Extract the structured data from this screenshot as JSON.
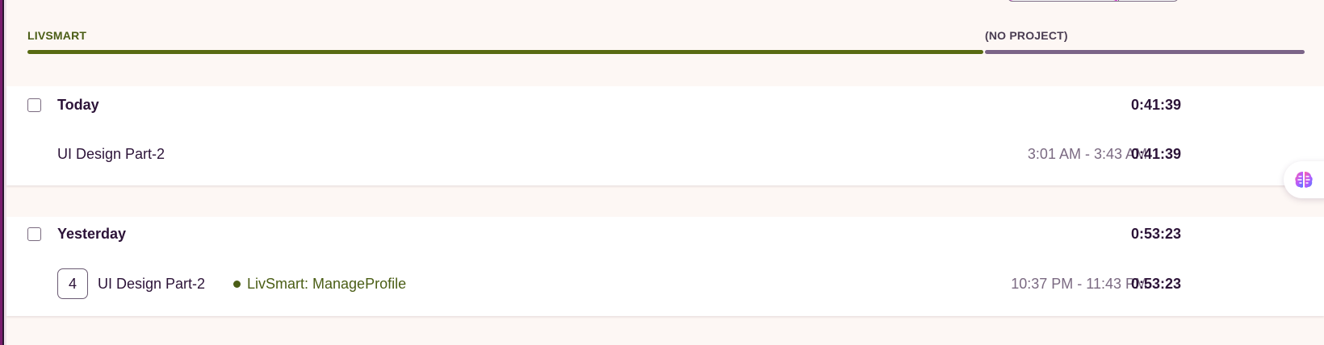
{
  "projects": [
    {
      "name": "LIVSMART",
      "color": "#586a12"
    },
    {
      "name": "(NO PROJECT)",
      "color": "#7b6487"
    }
  ],
  "groups": [
    {
      "title": "Today",
      "total": "0:41:39",
      "entries": [
        {
          "description": "UI Design Part-2",
          "time_range": "3:01 AM - 3:43 AM",
          "duration": "0:41:39"
        }
      ]
    },
    {
      "title": "Yesterday",
      "total": "0:53:23",
      "entries": [
        {
          "count": "4",
          "description": "UI Design Part-2",
          "project": "LivSmart: ManageProfile",
          "project_color": "#4b5e16",
          "time_range": "10:37 PM - 11:43 PM",
          "duration": "0:53:23"
        }
      ]
    }
  ],
  "floating": {
    "icon": "brain-icon"
  }
}
